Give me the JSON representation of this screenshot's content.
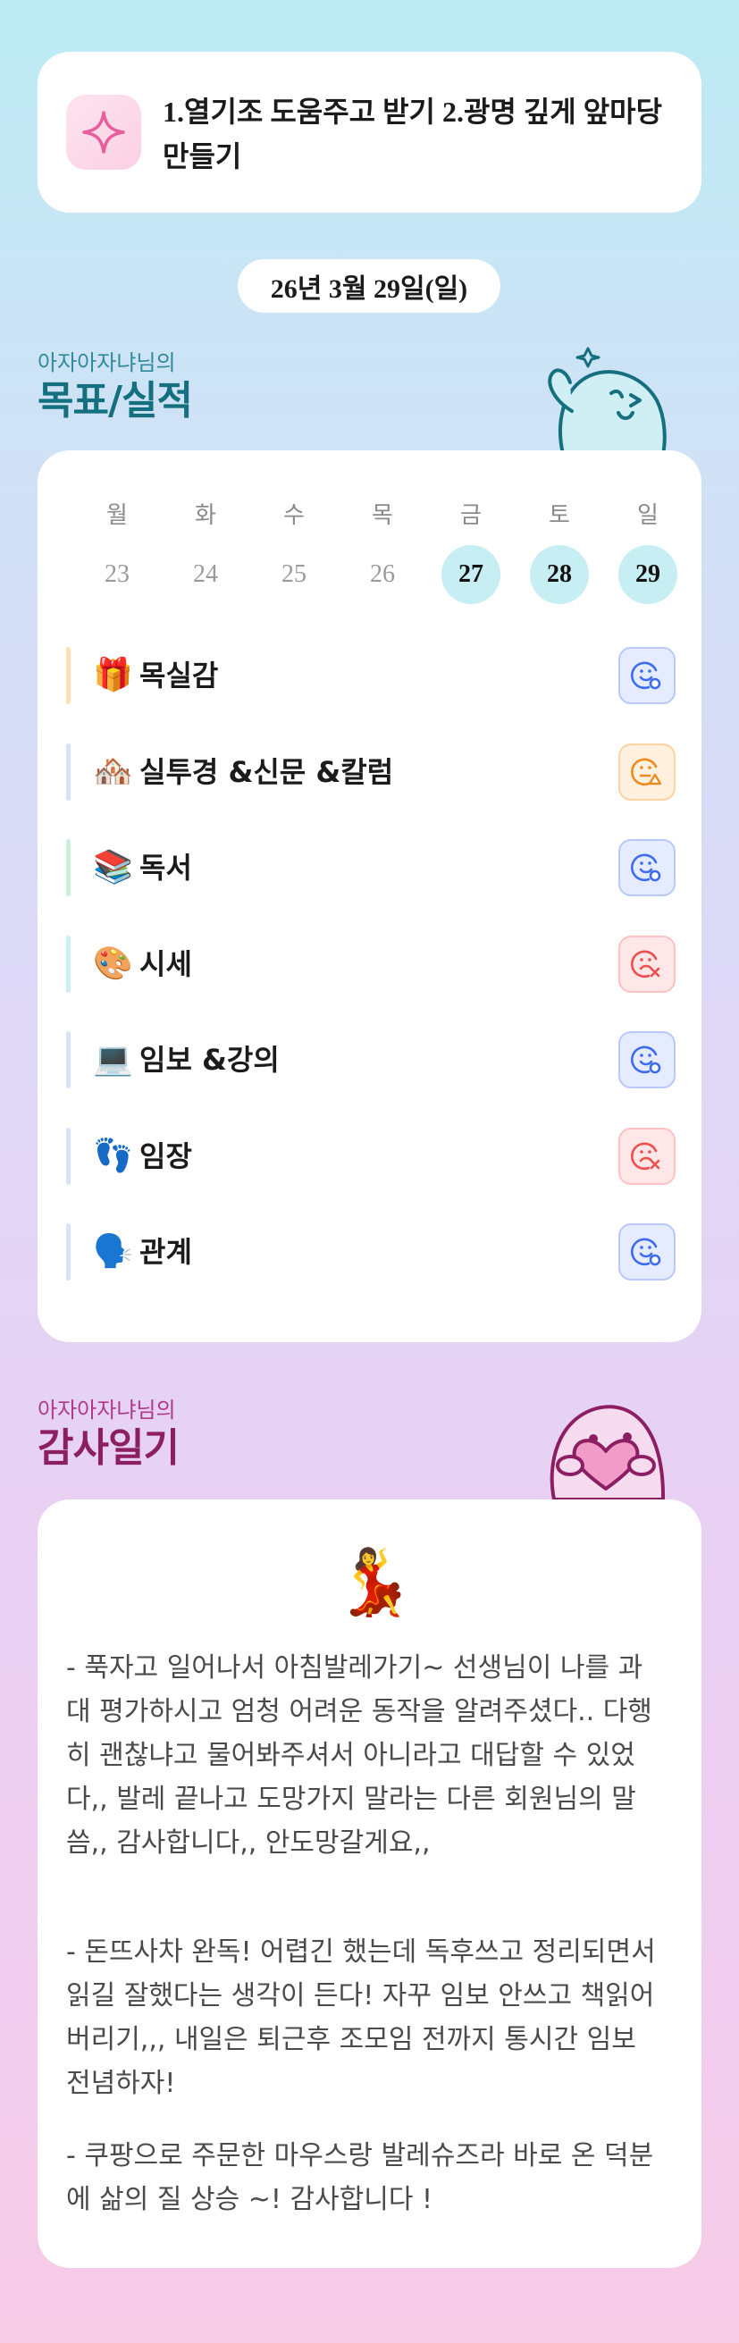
{
  "header": {
    "icon": "sparkle-icon",
    "text": "1.열기조 도움주고 받기 2.광명 깊게 앞마당 만들기"
  },
  "date": "26년 3월 29일(일)",
  "goals_section": {
    "subtitle": "아자아자냐님의",
    "title": "목표/실적",
    "weekdays": [
      "월",
      "화",
      "수",
      "목",
      "금",
      "토",
      "일"
    ],
    "dates": [
      "23",
      "24",
      "25",
      "26",
      "27",
      "28",
      "29"
    ],
    "active_dates": [
      "27",
      "28",
      "29"
    ],
    "items": [
      {
        "emoji": "🎁",
        "label": "목실감",
        "bar_color": "#ffe1b3",
        "status": "done"
      },
      {
        "emoji": "🏘️",
        "label": "실투경 &신문 &칼럼",
        "bar_color": "#d8e2fb",
        "status": "partial"
      },
      {
        "emoji": "📚",
        "label": "독서",
        "bar_color": "#c8f0dc",
        "status": "done"
      },
      {
        "emoji": "🎨",
        "label": "시세",
        "bar_color": "#c9f1f5",
        "status": "failed"
      },
      {
        "emoji": "💻",
        "label": "임보 &강의",
        "bar_color": "#d8e2fb",
        "status": "done"
      },
      {
        "emoji": "👣",
        "label": "임장",
        "bar_color": "#d8e2fb",
        "status": "failed"
      },
      {
        "emoji": "🗣️",
        "label": "관계",
        "bar_color": "#d8e2fb",
        "status": "done"
      }
    ],
    "colors": {
      "done": "#3d6cf0",
      "partial": "#f08a1c",
      "failed": "#ef4e4e"
    }
  },
  "gratitude_section": {
    "subtitle": "아자아자냐님의",
    "title": "감사일기",
    "emoji": "💃",
    "paragraphs": [
      "- 푹자고 일어나서 아침발레가기~ 선생님이 나를 과\n대 평가하시고 엄청 어려운 동작을 알려주셨다.. 다행\n히 괜찮냐고 물어봐주셔서 아니라고 대답할 수 있었\n다,, 발레 끝나고 도망가지 말라는 다른 회원님의 말\n씀,, 감사합니다,, 안도망갈게요,,",
      "- 돈뜨사차 완독! 어렵긴 했는데 독후쓰고 정리되면서\n읽길 잘했다는 생각이 든다! 자꾸 임보 안쓰고 책읽어\n버리기,,, 내일은 퇴근후 조모임 전까지 통시간 임보\n전념하자!",
      "- 쿠팡으로 주문한 마우스랑 발레슈즈라 바로 온 덕분\n에 삶의 질 상승 ~! 감사합니다 !"
    ]
  }
}
